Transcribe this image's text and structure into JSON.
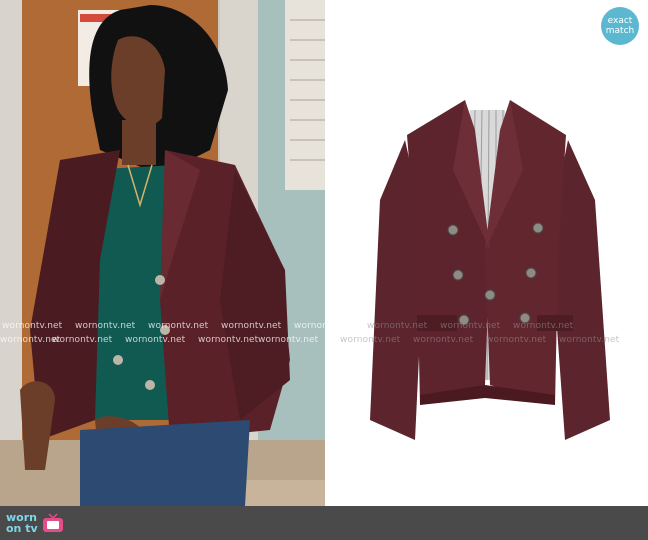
{
  "badge": {
    "line1": "exact",
    "line2": "match"
  },
  "watermark": {
    "text": "wornontv.net"
  },
  "logo": {
    "line1": "worn",
    "line2_a": "on",
    "line2_b": "tv"
  },
  "colors": {
    "leather": "#5a2129",
    "badge": "#5bb8d0",
    "bar": "#4a4a4a",
    "logo": "#7fd6e8"
  },
  "icons": [
    "tv-icon"
  ]
}
